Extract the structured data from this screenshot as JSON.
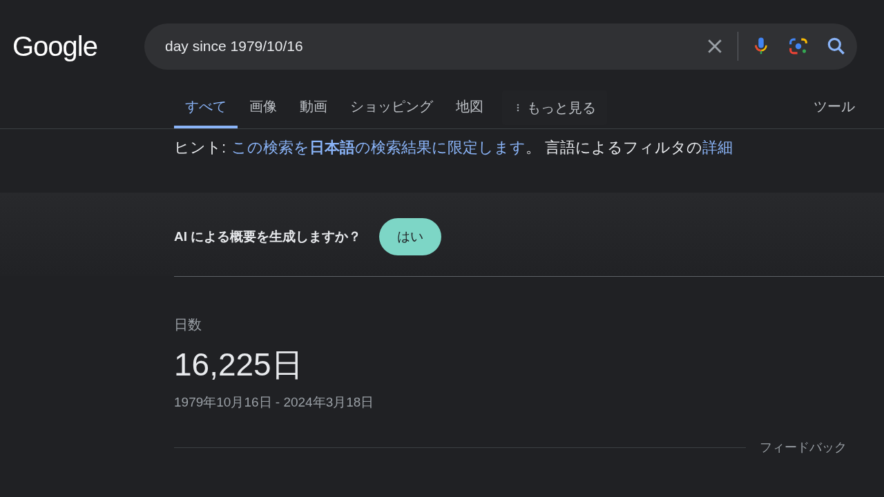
{
  "logo": "Google",
  "search": {
    "value": "day since 1979/10/16"
  },
  "tabs": [
    {
      "label": "すべて",
      "selected": true
    },
    {
      "label": "画像",
      "selected": false
    },
    {
      "label": "動画",
      "selected": false
    },
    {
      "label": "ショッピング",
      "selected": false
    },
    {
      "label": "地図",
      "selected": false
    }
  ],
  "more": {
    "label": "もっと見る"
  },
  "tools": {
    "label": "ツール"
  },
  "hint": {
    "label": "ヒント:",
    "segments": [
      {
        "kind": "link",
        "text": "この検索を**日本語**の検索結果に限定します"
      },
      {
        "kind": "text",
        "text": "。 言語によるフィルタの"
      },
      {
        "kind": "link",
        "text": "詳細"
      }
    ]
  },
  "ai_prompt": {
    "question": "AI による概要を生成しますか？",
    "button": "はい"
  },
  "result": {
    "label": "日数",
    "value": "16,225日",
    "range": "1979年10月16日 - 2024年3月18日",
    "feedback": "フィードバック"
  }
}
